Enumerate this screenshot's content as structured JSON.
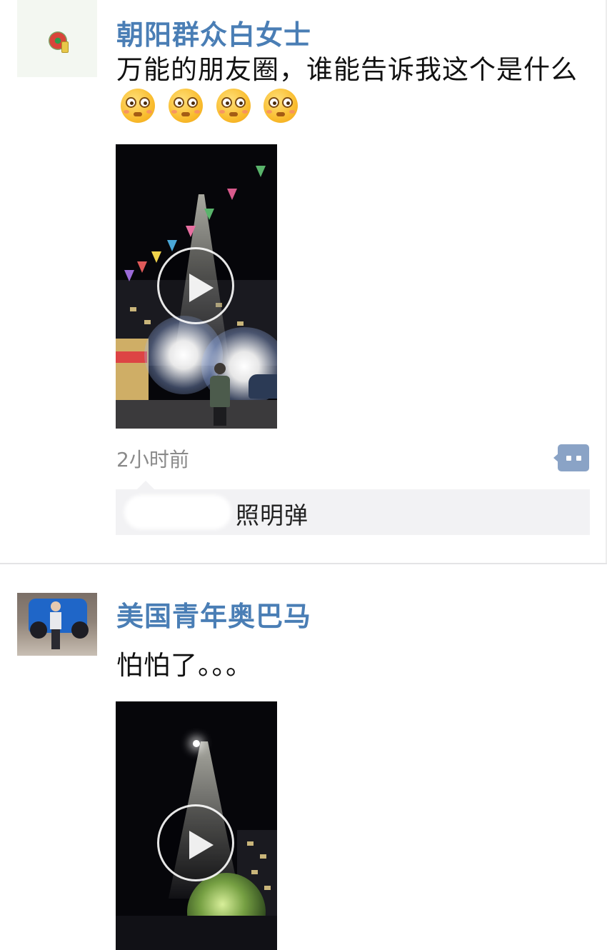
{
  "posts": [
    {
      "username": "朝阳群众白女士",
      "text": "万能的朋友圈，谁能告诉我这个是什么",
      "emoji": "flushed-face-emoji",
      "emoji_count": 4,
      "time": "2小时前",
      "comments": [
        {
          "author": "",
          "text": "照明弹"
        }
      ],
      "video": {
        "play_icon": "play-icon"
      }
    },
    {
      "username": "美国青年奥巴马",
      "text": "怕怕了。。。",
      "video": {
        "play_icon": "play-icon"
      }
    }
  ],
  "colors": {
    "username": "#4a7eb5",
    "timestamp": "#8a8a8a",
    "comment_button": "#8aa3c6",
    "comment_bg": "#f2f2f4"
  }
}
